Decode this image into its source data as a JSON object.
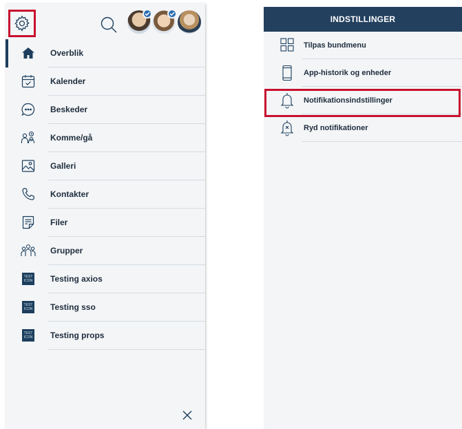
{
  "left_menu": {
    "items": [
      {
        "label": "Overblik",
        "icon": "home-icon",
        "active": true
      },
      {
        "label": "Kalender",
        "icon": "calendar-icon"
      },
      {
        "label": "Beskeder",
        "icon": "chat-bubble-icon"
      },
      {
        "label": "Komme/gå",
        "icon": "people-clock-icon"
      },
      {
        "label": "Galleri",
        "icon": "gallery-icon"
      },
      {
        "label": "Kontakter",
        "icon": "phone-icon"
      },
      {
        "label": "Filer",
        "icon": "file-icon"
      },
      {
        "label": "Grupper",
        "icon": "group-icon"
      },
      {
        "label": "Testing axios",
        "icon": "test-icon"
      },
      {
        "label": "Testing sso",
        "icon": "test-icon"
      },
      {
        "label": "Testing props",
        "icon": "test-icon"
      }
    ],
    "test_icon_text": [
      "TEST",
      "ICON"
    ]
  },
  "top_bar": {
    "icons": [
      "gear-icon",
      "search-icon"
    ],
    "avatars": 3
  },
  "settings_panel": {
    "title": "INDSTILLINGER",
    "items": [
      {
        "label": "Tilpas bundmenu",
        "icon": "grid-icon"
      },
      {
        "label": "App-historik og enheder",
        "icon": "phone-device-icon"
      },
      {
        "label": "Notifikationsindstillinger",
        "icon": "bell-icon"
      },
      {
        "label": "Ryd notifikationer",
        "icon": "bell-clear-icon"
      }
    ]
  },
  "colors": {
    "accent": "#1c3e5c",
    "header_bg": "#23405f",
    "highlight": "#c8102e",
    "panel_bg": "#f3f5f7"
  }
}
